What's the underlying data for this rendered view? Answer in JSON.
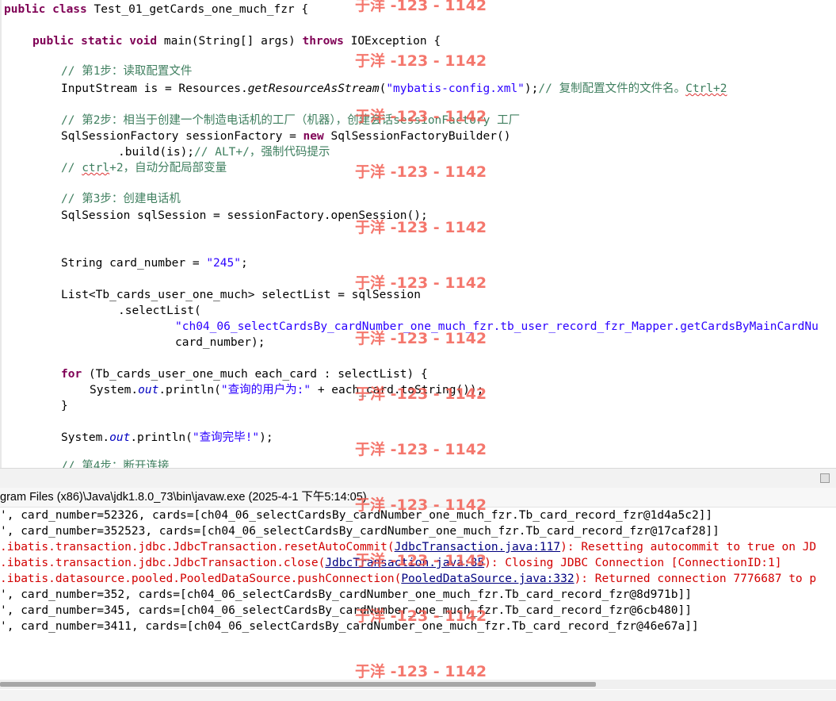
{
  "editor": {
    "class_decl": {
      "kw": "public class",
      "rest": " Test_01_getCards_one_much_fzr {"
    },
    "main_decl": {
      "kw": "public static void",
      "mid": " main(String[] args) ",
      "throws": "throws",
      "rest": " IOException {"
    },
    "c_step1": "// 第1步：读取配置文件",
    "l_input": {
      "a": "InputStream is = Resources.",
      "m": "getResourceAsStream",
      "b": "(",
      "s": "\"mybatis-config.xml\"",
      "c": ");",
      "cm": "// 复制配置文件的文件名。",
      "sq": "Ctrl+2"
    },
    "c_step2": "// 第2步：相当于创建一个制造电话机的工厂（机器），创建会话sessionFactory 工厂",
    "l_factory": {
      "a": "SqlSessionFactory sessionFactory = ",
      "kw": "new",
      "b": " SqlSessionFactoryBuilder()"
    },
    "l_build": {
      "a": ".build(is);",
      "cm": "// ALT+/，强制代码提示"
    },
    "c_ctrl": {
      "a": "// ",
      "sq": "ctrl",
      "b": "+2，自动分配局部变量"
    },
    "c_step3": "// 第3步：创建电话机",
    "l_session": "SqlSession sqlSession = sessionFactory.openSession();",
    "l_cardnum": {
      "a": "String card_number = ",
      "s": "\"245\"",
      "b": ";"
    },
    "l_list": "List<Tb_cards_user_one_much> selectList = sqlSession",
    "l_select": ".selectList(",
    "l_stmt": "\"ch04_06_selectCardsBy_cardNumber_one_much_fzr.tb_user_record_fzr_Mapper.getCardsByMainCardNu",
    "l_arg": "card_number);",
    "l_for": {
      "kw": "for",
      "rest": " (Tb_cards_user_one_much each_card : selectList) {"
    },
    "l_print1": {
      "a": "System.",
      "f": "out",
      "b": ".println(",
      "s": "\"查询的用户为:\"",
      "c": " + each_card.toString());"
    },
    "l_close": "}",
    "l_print2": {
      "a": "System.",
      "f": "out",
      "b": ".println(",
      "s": "\"查询完毕!\"",
      "c": ");"
    },
    "c_step4": "// 第4步：断开连接"
  },
  "console": {
    "title": "gram Files (x86)\\Java\\jdk1.8.0_73\\bin\\javaw.exe (2025-4-1 下午5:14:05)",
    "lines": [
      {
        "type": "out",
        "text": "', card_number=52326, cards=[ch04_06_selectCardsBy_cardNumber_one_much_fzr.Tb_card_record_fzr@1d4a5c2]]"
      },
      {
        "type": "out",
        "text": "', card_number=352523, cards=[ch04_06_selectCardsBy_cardNumber_one_much_fzr.Tb_card_record_fzr@17caf28]]"
      },
      {
        "type": "err",
        "a": ".ibatis.transaction.jdbc.JdbcTransaction.resetAutoCommit(",
        "link": "JdbcTransaction.java:117",
        "b": "): Resetting autocommit to true on JD"
      },
      {
        "type": "err",
        "a": ".ibatis.transaction.jdbc.JdbcTransaction.close(",
        "link": "JdbcTransaction.java:85",
        "b": "): Closing JDBC Connection [ConnectionID:1]"
      },
      {
        "type": "err",
        "a": ".ibatis.datasource.pooled.PooledDataSource.pushConnection(",
        "link": "PooledDataSource.java:332",
        "b": "): Returned connection 7776687 to p"
      },
      {
        "type": "out",
        "text": "', card_number=352, cards=[ch04_06_selectCardsBy_cardNumber_one_much_fzr.Tb_card_record_fzr@8d971b]]"
      },
      {
        "type": "out",
        "text": "', card_number=345, cards=[ch04_06_selectCardsBy_cardNumber_one_much_fzr.Tb_card_record_fzr@6cb480]]"
      },
      {
        "type": "out",
        "text": "', card_number=3411, cards=[ch04_06_selectCardsBy_cardNumber_one_much_fzr.Tb_card_record_fzr@46e67a]]"
      }
    ]
  },
  "watermark": "于洋 -123 - 1142"
}
